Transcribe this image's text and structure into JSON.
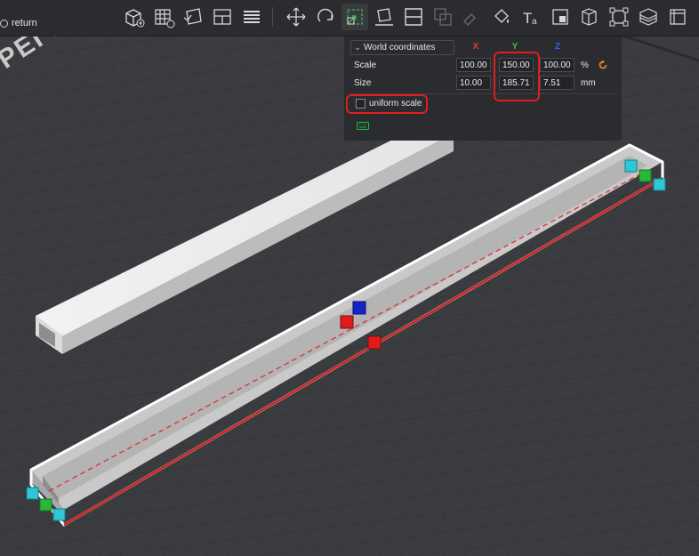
{
  "toolbar": {
    "return_label": "return",
    "tools": [
      {
        "name": "add-cube-icon"
      },
      {
        "name": "arrange-grid-icon"
      },
      {
        "name": "orient-icon"
      },
      {
        "name": "split-objects-icon"
      },
      {
        "name": "layers-icon"
      },
      {
        "name": "move-icon"
      },
      {
        "name": "rotate-icon"
      },
      {
        "name": "scale-icon"
      },
      {
        "name": "place-on-face-icon"
      },
      {
        "name": "cut-icon"
      },
      {
        "name": "boolean-icon"
      },
      {
        "name": "support-paint-icon"
      },
      {
        "name": "color-paint-icon"
      },
      {
        "name": "text-icon"
      },
      {
        "name": "svg-icon"
      },
      {
        "name": "measure-icon"
      },
      {
        "name": "assembly-icon"
      },
      {
        "name": "slice-view-icon"
      },
      {
        "name": "more-icon"
      }
    ]
  },
  "plate": {
    "label": "PEI Plate"
  },
  "panel": {
    "coord_system": "World coordinates",
    "axes": {
      "x": "X",
      "y": "Y",
      "z": "Z"
    },
    "axis_colors": {
      "x": "#e23b3b",
      "y": "#33c24d",
      "z": "#3a5cf0"
    },
    "scale": {
      "label": "Scale",
      "x": "100.00",
      "y": "150.00",
      "z": "100.00",
      "unit": "%"
    },
    "size": {
      "label": "Size",
      "x": "10.00",
      "y": "185.71",
      "z": "7.51",
      "unit": "mm"
    },
    "uniform_scale": {
      "label": "uniform scale",
      "checked": false
    },
    "accent": "#e8891a",
    "highlight": "#e21d1d"
  }
}
